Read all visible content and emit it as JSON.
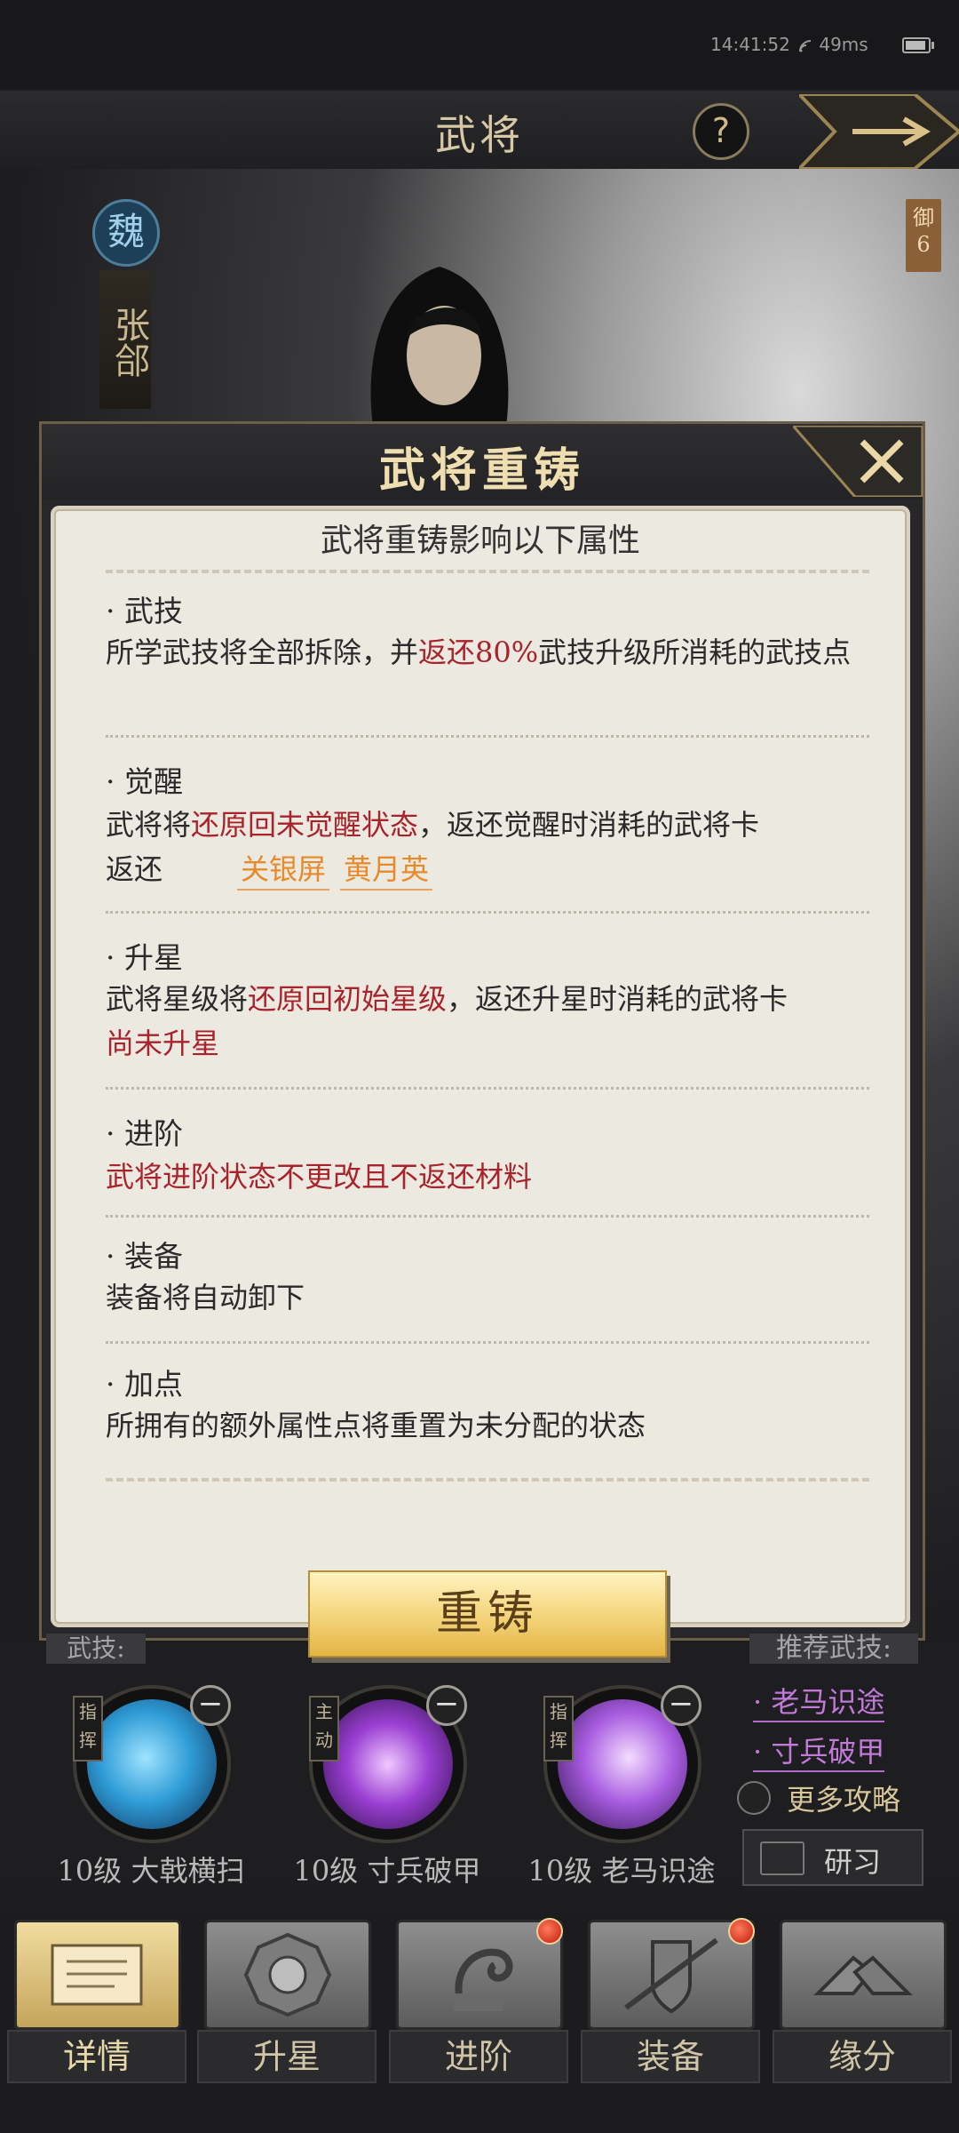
{
  "status_bar": {
    "time": "14:41:52",
    "latency": "49ms"
  },
  "header": {
    "title": "武将",
    "help_label": "?"
  },
  "hero": {
    "faction": "魏",
    "name": "张郃",
    "defense_tag": "御",
    "defense_value": "6"
  },
  "dialog": {
    "title": "武将重铸",
    "subtitle": "武将重铸影响以下属性",
    "sections": [
      {
        "head": "· 武技",
        "text_a": "所学武技将全部拆除，并",
        "red_a": "返还80%",
        "text_b": "武技升级所消耗的武技点"
      },
      {
        "head": "· 觉醒",
        "text_a": "武将将",
        "red_a": "还原回未觉醒状态",
        "text_b": "，返还觉醒时消耗的武将卡",
        "return_label": "返还",
        "cards": [
          "关银屏",
          "黄月英"
        ]
      },
      {
        "head": "· 升星",
        "text_a": "武将星级将",
        "red_a": "还原回初始星级",
        "text_b": "，返还升星时消耗的武将卡",
        "red_line": "尚未升星"
      },
      {
        "head": "· 进阶",
        "red_line": "武将进阶状态不更改且不返还材料"
      },
      {
        "head": "· 装备",
        "text": "装备将自动卸下"
      },
      {
        "head": "· 加点",
        "text": "所拥有的额外属性点将重置为未分配的状态"
      }
    ],
    "button_label": "重铸"
  },
  "skills": {
    "label": "武技:",
    "items": [
      {
        "tag": "指挥",
        "name": "10级 大戟横扫",
        "minus": "−",
        "color": "#2f9cd6"
      },
      {
        "tag": "主动",
        "name": "10级 寸兵破甲",
        "minus": "−",
        "color": "#9a3fd2"
      },
      {
        "tag": "指挥",
        "name": "10级 老马识途",
        "minus": "−",
        "color": "#a85ce0"
      }
    ]
  },
  "recommended": {
    "label": "推荐武技:",
    "links": [
      "· 老马识途",
      "· 寸兵破甲"
    ],
    "more_label": "更多攻略",
    "study_label": "研习"
  },
  "bottom_nav": [
    {
      "label": "详情",
      "active": true,
      "badge": false,
      "icon": "scroll-icon"
    },
    {
      "label": "升星",
      "active": false,
      "badge": false,
      "icon": "bagua-icon"
    },
    {
      "label": "进阶",
      "active": false,
      "badge": true,
      "icon": "dragon-icon"
    },
    {
      "label": "装备",
      "active": false,
      "badge": true,
      "icon": "shield-icon"
    },
    {
      "label": "缘分",
      "active": false,
      "badge": false,
      "icon": "handshake-icon"
    }
  ]
}
